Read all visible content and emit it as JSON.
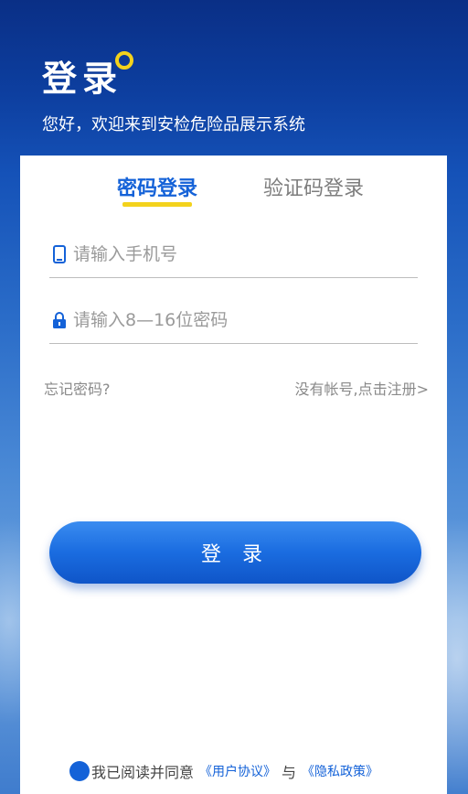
{
  "header": {
    "title": "登录",
    "subtitle": "您好，欢迎来到安检危险品展示系统"
  },
  "tabs": [
    {
      "label": "密码登录",
      "active": true
    },
    {
      "label": "验证码登录",
      "active": false
    }
  ],
  "form": {
    "phone": {
      "placeholder": "请输入手机号",
      "value": "",
      "icon": "phone-icon"
    },
    "password": {
      "placeholder": "请输入8—16位密码",
      "value": "",
      "icon": "lock-icon"
    }
  },
  "links": {
    "forgot": "忘记密码?",
    "register": "没有帐号,点击注册>"
  },
  "login_button": "登 录",
  "agreement": {
    "prefix": "我已阅读并同意",
    "user_agreement": "《用户协议》",
    "and": "与",
    "privacy_policy": "《隐私政策》"
  },
  "colors": {
    "primary": "#1462d8",
    "accent": "#f3d21c",
    "background_top": "#0a2f86"
  }
}
